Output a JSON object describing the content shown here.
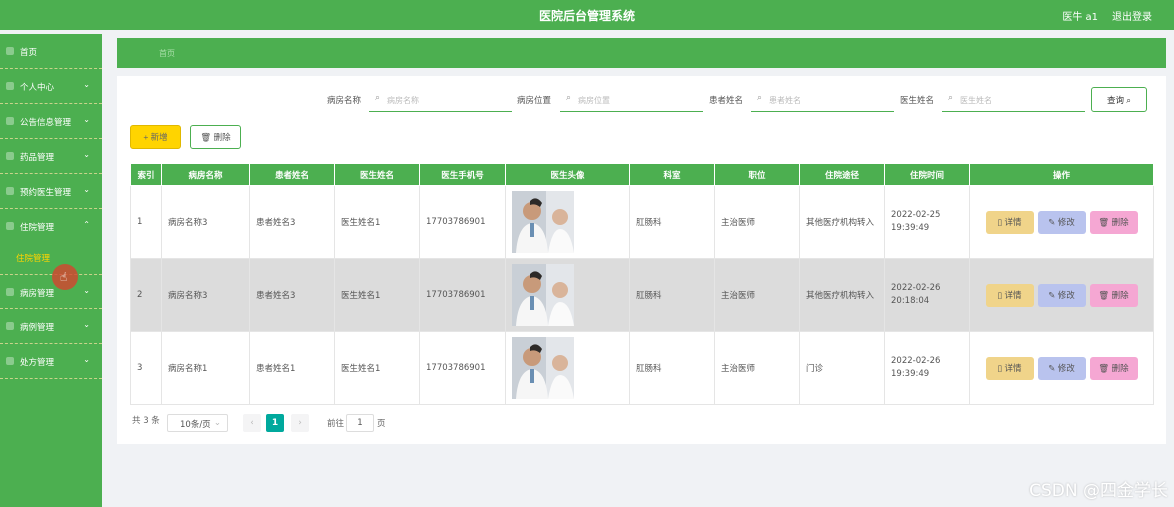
{
  "header": {
    "title": "医院后台管理系统",
    "user": "医牛 a1",
    "logout": "退出登录"
  },
  "sidebar": {
    "items": [
      {
        "label": "首页",
        "chevron": ""
      },
      {
        "label": "个人中心",
        "chevron": "⌄"
      },
      {
        "label": "公告信息管理",
        "chevron": "⌄"
      },
      {
        "label": "药品管理",
        "chevron": "⌄"
      },
      {
        "label": "预约医生管理",
        "chevron": "⌄"
      },
      {
        "label": "住院管理",
        "chevron": "⌃"
      },
      {
        "label": "病房管理",
        "chevron": "⌄"
      },
      {
        "label": "病例管理",
        "chevron": "⌄"
      },
      {
        "label": "处方管理",
        "chevron": "⌄"
      }
    ],
    "active_sub": "住院管理"
  },
  "breadcrumb": "首页",
  "search": {
    "fields": [
      {
        "label": "病房名称",
        "placeholder": "病房名称"
      },
      {
        "label": "病房位置",
        "placeholder": "病房位置"
      },
      {
        "label": "患者姓名",
        "placeholder": "患者姓名"
      },
      {
        "label": "医生姓名",
        "placeholder": "医生姓名"
      }
    ],
    "query_label": "查询 ⌕"
  },
  "actions": {
    "add_label": "+ 新增",
    "delete_label": "🗑 删除"
  },
  "table": {
    "headers": [
      "索引",
      "病房名称",
      "患者姓名",
      "医生姓名",
      "医生手机号",
      "医生头像",
      "科室",
      "职位",
      "住院途径",
      "住院时间",
      "操作"
    ],
    "rows": [
      {
        "index": "1",
        "ward": "病房名称3",
        "patient": "患者姓名3",
        "doctor": "医生姓名1",
        "phone": "17703786901",
        "dept": "肛肠科",
        "title": "主治医师",
        "route": "其他医疗机构转入",
        "time": "2022-02-25 19:39:49"
      },
      {
        "index": "2",
        "ward": "病房名称3",
        "patient": "患者姓名3",
        "doctor": "医生姓名1",
        "phone": "17703786901",
        "dept": "肛肠科",
        "title": "主治医师",
        "route": "其他医疗机构转入",
        "time": "2022-02-26 20:18:04"
      },
      {
        "index": "3",
        "ward": "病房名称1",
        "patient": "患者姓名1",
        "doctor": "医生姓名1",
        "phone": "17703786901",
        "dept": "肛肠科",
        "title": "主治医师",
        "route": "门诊",
        "time": "2022-02-26 19:39:49"
      }
    ],
    "op_labels": {
      "detail": "详情",
      "edit": "修改",
      "delete": "删除"
    }
  },
  "pagination": {
    "total": "共 3 条",
    "page_size": "10条/页",
    "current": "1",
    "goto_label": "前往",
    "goto_value": "1",
    "page_suffix": "页"
  },
  "watermark": "CSDN @四金学长",
  "colors": {
    "primary": "#4caf50",
    "accent_yellow": "#ffd400",
    "detail": "#f0d48a",
    "edit": "#b9c3ee",
    "delete": "#f5a7d3",
    "page_active": "#00a99d"
  }
}
